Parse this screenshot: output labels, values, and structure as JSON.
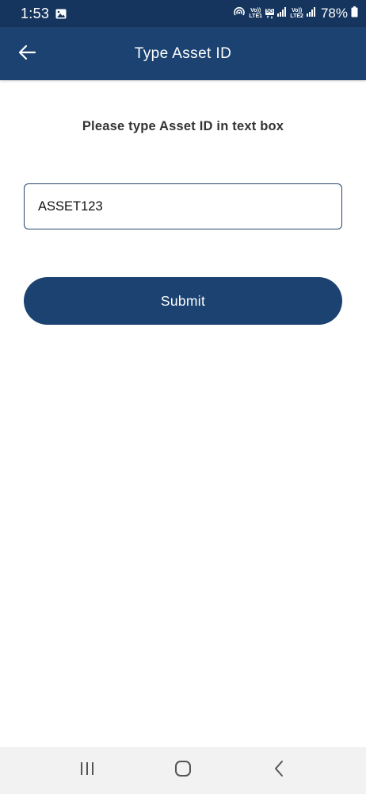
{
  "status_bar": {
    "time": "1:53",
    "network_1": [
      "Vo))",
      "LTE1"
    ],
    "badge_5g": "5G",
    "network_2": [
      "Vo))",
      "LTE2"
    ],
    "battery": "78%"
  },
  "app_bar": {
    "title": "Type Asset ID"
  },
  "form": {
    "instruction": "Please type Asset ID in text box",
    "asset_id_value": "ASSET123",
    "submit_label": "Submit"
  },
  "icons": {
    "back": "arrow-left-icon",
    "gallery": "image-icon",
    "hotspot": "hotspot-icon",
    "signal": "signal-icon",
    "battery": "battery-icon",
    "recents": "recents-icon",
    "home": "home-icon",
    "nav_back": "chevron-left-icon"
  },
  "colors": {
    "status_bar": "#16355e",
    "app_bar": "#1b4271",
    "button": "#1b4271",
    "input_border": "#27466d"
  }
}
